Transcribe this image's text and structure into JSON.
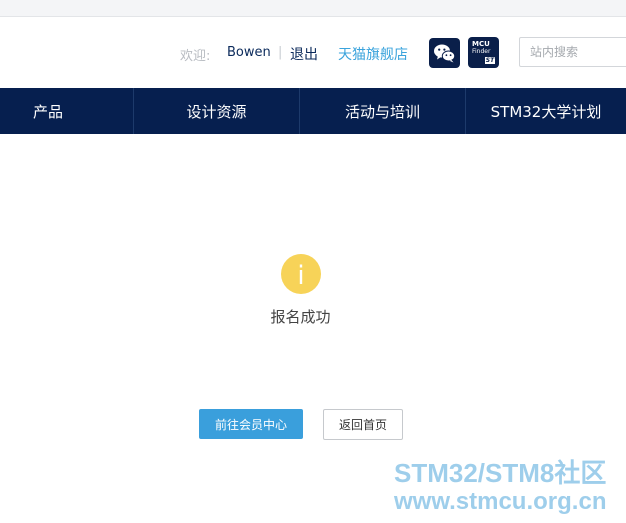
{
  "header": {
    "welcome_label": "欢迎:",
    "username": "Bowen",
    "separator": "|",
    "logout_label": "退出",
    "tmall_label": "天猫旗舰店",
    "mcu_finder": {
      "line1": "MCU",
      "line2": "Finder",
      "badge": "ST"
    },
    "search": {
      "placeholder": "站内搜索"
    }
  },
  "nav": {
    "items": [
      {
        "label": "产品"
      },
      {
        "label": "设计资源"
      },
      {
        "label": "活动与培训"
      },
      {
        "label": "STM32大学计划"
      }
    ]
  },
  "main": {
    "status_icon": "info-icon",
    "status_icon_color": "#f7d358",
    "status_glyph": "i",
    "message": "报名成功",
    "primary_button": "前往会员中心",
    "secondary_button": "返回首页"
  },
  "watermark": {
    "line1": "STM32/STM8社区",
    "line2": "www.stmcu.org.cn"
  }
}
